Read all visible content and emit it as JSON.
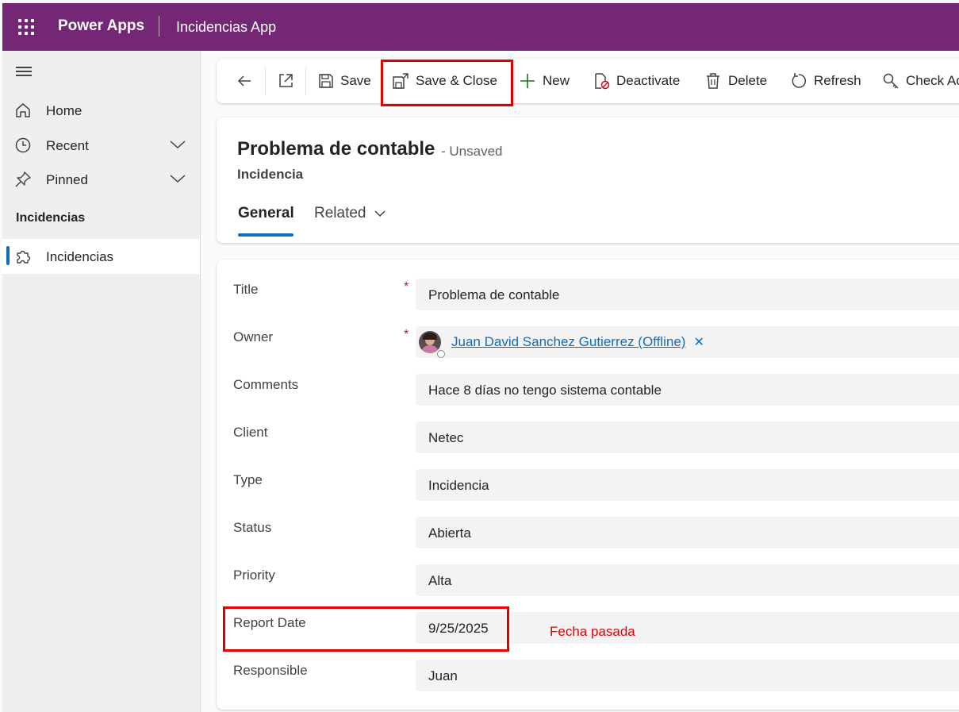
{
  "header": {
    "app_name": "Power Apps",
    "app_title": "Incidencias App",
    "bg_color": "#742774"
  },
  "sidebar": {
    "items": [
      {
        "label": "Home",
        "icon": "home-icon"
      },
      {
        "label": "Recent",
        "icon": "clock-icon"
      },
      {
        "label": "Pinned",
        "icon": "pin-icon"
      }
    ],
    "section_title": "Incidencias",
    "entities": [
      {
        "label": "Incidencias",
        "icon": "puzzle-icon",
        "selected": true
      }
    ]
  },
  "commandbar": {
    "save": "Save",
    "save_close": "Save & Close",
    "new": "New",
    "deactivate": "Deactivate",
    "delete": "Delete",
    "refresh": "Refresh",
    "check_access": "Check Ac"
  },
  "record": {
    "title": "Problema de contable",
    "status_suffix": "- Unsaved",
    "entity": "Incidencia",
    "tabs": {
      "general": "General",
      "related": "Related"
    }
  },
  "form": {
    "required_mark": "*",
    "fields": {
      "title": {
        "label": "Title",
        "value": "Problema de contable"
      },
      "owner": {
        "label": "Owner",
        "value": "Juan David Sanchez Gutierrez (Offline)"
      },
      "comments": {
        "label": "Comments",
        "value": "Hace 8 días no tengo sistema contable"
      },
      "client": {
        "label": "Client",
        "value": "Netec"
      },
      "type": {
        "label": "Type",
        "value": "Incidencia"
      },
      "status": {
        "label": "Status",
        "value": "Abierta"
      },
      "priority": {
        "label": "Priority",
        "value": "Alta"
      },
      "report_date": {
        "label": "Report Date",
        "value": "9/25/2025"
      },
      "responsible": {
        "label": "Responsible",
        "value": "Juan"
      }
    }
  },
  "annotation": {
    "text": "Fecha pasada",
    "color": "#e00000"
  },
  "accent_color": "#0f6cbd"
}
